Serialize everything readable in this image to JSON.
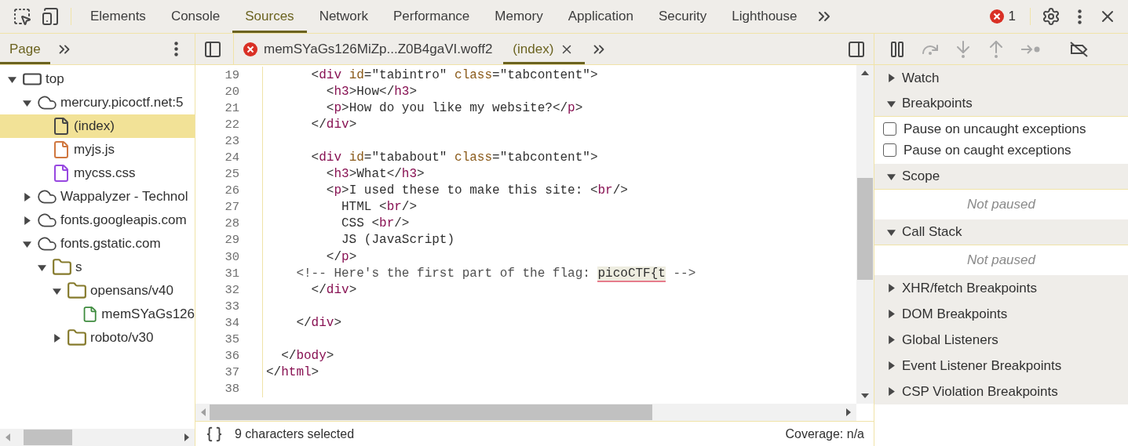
{
  "main_tabs": [
    {
      "label": "Elements",
      "selected": false
    },
    {
      "label": "Console",
      "selected": false
    },
    {
      "label": "Sources",
      "selected": true
    },
    {
      "label": "Network",
      "selected": false
    },
    {
      "label": "Performance",
      "selected": false
    },
    {
      "label": "Memory",
      "selected": false
    },
    {
      "label": "Application",
      "selected": false
    },
    {
      "label": "Security",
      "selected": false
    },
    {
      "label": "Lighthouse",
      "selected": false
    }
  ],
  "error_count": "1",
  "navigator_tabs": [
    {
      "label": "Page",
      "selected": true
    }
  ],
  "editor_tabs": [
    {
      "label": "memSYaGs126MiZp...Z0B4gaVI.woff2",
      "selected": false,
      "error": true
    },
    {
      "label": "(index)",
      "selected": true,
      "error": false
    }
  ],
  "debugger_controls": [
    {
      "kind": "pause",
      "disabled": false
    },
    {
      "kind": "step_over",
      "disabled": true
    },
    {
      "kind": "step_into",
      "disabled": true
    },
    {
      "kind": "step_out",
      "disabled": true
    },
    {
      "kind": "step",
      "disabled": true
    },
    {
      "kind": "deactivate",
      "disabled": false
    }
  ],
  "tree": [
    {
      "label": "top",
      "kind": "frame",
      "expanded": true,
      "selected": false,
      "children": [
        {
          "label": "mercury.picoctf.net:5",
          "kind": "domain",
          "expanded": true,
          "selected": false,
          "children": [
            {
              "label": "(index)",
              "kind": "file",
              "color": "#474747",
              "selected": true
            },
            {
              "label": "myjs.js",
              "kind": "file",
              "color": "#d0773f",
              "selected": false
            },
            {
              "label": "mycss.css",
              "kind": "file",
              "color": "#9747e0",
              "selected": false
            }
          ]
        },
        {
          "label": "Wappalyzer - Technol",
          "kind": "domain",
          "expanded": false,
          "selected": false
        },
        {
          "label": "fonts.googleapis.com",
          "kind": "domain",
          "expanded": false,
          "selected": false
        },
        {
          "label": "fonts.gstatic.com",
          "kind": "domain",
          "expanded": true,
          "selected": false,
          "children": [
            {
              "label": "s",
              "kind": "folder",
              "expanded": true,
              "selected": false,
              "children": [
                {
                  "label": "opensans/v40",
                  "kind": "folder",
                  "expanded": true,
                  "selected": false,
                  "children": [
                    {
                      "label": "memSYaGs126",
                      "kind": "file",
                      "color": "#3d8b3d",
                      "selected": false
                    }
                  ]
                },
                {
                  "label": "roboto/v30",
                  "kind": "folder",
                  "expanded": false,
                  "selected": false
                }
              ]
            }
          ]
        }
      ]
    }
  ],
  "code_lines": [
    {
      "number": "19",
      "tokens": [
        {
          "kind": "punct",
          "text": "      <"
        },
        {
          "kind": "tag",
          "text": "div "
        },
        {
          "kind": "attr",
          "text": "id"
        },
        {
          "kind": "punct",
          "text": "=\"tabintro\" "
        },
        {
          "kind": "attr",
          "text": "class"
        },
        {
          "kind": "punct",
          "text": "=\"tabcontent\">"
        }
      ]
    },
    {
      "number": "20",
      "tokens": [
        {
          "kind": "punct",
          "text": "        <"
        },
        {
          "kind": "tag",
          "text": "h3"
        },
        {
          "kind": "punct",
          "text": ">How</"
        },
        {
          "kind": "tag",
          "text": "h3"
        },
        {
          "kind": "punct",
          "text": ">"
        }
      ]
    },
    {
      "number": "21",
      "tokens": [
        {
          "kind": "punct",
          "text": "        <"
        },
        {
          "kind": "tag",
          "text": "p"
        },
        {
          "kind": "punct",
          "text": ">How do you like my website?</"
        },
        {
          "kind": "tag",
          "text": "p"
        },
        {
          "kind": "punct",
          "text": ">"
        }
      ]
    },
    {
      "number": "22",
      "tokens": [
        {
          "kind": "punct",
          "text": "      </"
        },
        {
          "kind": "tag",
          "text": "div"
        },
        {
          "kind": "punct",
          "text": ">"
        }
      ]
    },
    {
      "number": "23"
    },
    {
      "number": "24",
      "tokens": [
        {
          "kind": "punct",
          "text": "      <"
        },
        {
          "kind": "tag",
          "text": "div "
        },
        {
          "kind": "attr",
          "text": "id"
        },
        {
          "kind": "punct",
          "text": "=\"tababout\" "
        },
        {
          "kind": "attr",
          "text": "class"
        },
        {
          "kind": "punct",
          "text": "=\"tabcontent\">"
        }
      ]
    },
    {
      "number": "25",
      "tokens": [
        {
          "kind": "punct",
          "text": "        <"
        },
        {
          "kind": "tag",
          "text": "h3"
        },
        {
          "kind": "punct",
          "text": ">What</"
        },
        {
          "kind": "tag",
          "text": "h3"
        },
        {
          "kind": "punct",
          "text": ">"
        }
      ]
    },
    {
      "number": "26",
      "tokens": [
        {
          "kind": "punct",
          "text": "        <"
        },
        {
          "kind": "tag",
          "text": "p"
        },
        {
          "kind": "punct",
          "text": ">I used these to make this site: <"
        },
        {
          "kind": "tag",
          "text": "br"
        },
        {
          "kind": "punct",
          "text": "/>"
        }
      ]
    },
    {
      "number": "27",
      "tokens": [
        {
          "kind": "punct",
          "text": "          HTML <"
        },
        {
          "kind": "tag",
          "text": "br"
        },
        {
          "kind": "punct",
          "text": "/>"
        }
      ]
    },
    {
      "number": "28",
      "tokens": [
        {
          "kind": "punct",
          "text": "          CSS <"
        },
        {
          "kind": "tag",
          "text": "br"
        },
        {
          "kind": "punct",
          "text": "/>"
        }
      ]
    },
    {
      "number": "29",
      "tokens": [
        {
          "kind": "punct",
          "text": "          JS (JavaScript)"
        }
      ]
    },
    {
      "number": "30",
      "tokens": [
        {
          "kind": "punct",
          "text": "        </"
        },
        {
          "kind": "tag",
          "text": "p"
        },
        {
          "kind": "punct",
          "text": ">"
        }
      ]
    },
    {
      "number": "31",
      "tokens": [
        {
          "kind": "comment",
          "text": "    <!-- Here's the first part of the flag: "
        },
        {
          "kind": "selection",
          "text": "picoCTF{t"
        },
        {
          "kind": "comment",
          "text": " -->"
        }
      ]
    },
    {
      "number": "32",
      "tokens": [
        {
          "kind": "punct",
          "text": "      </"
        },
        {
          "kind": "tag",
          "text": "div"
        },
        {
          "kind": "punct",
          "text": ">"
        }
      ]
    },
    {
      "number": "33"
    },
    {
      "number": "34",
      "tokens": [
        {
          "kind": "punct",
          "text": "    </"
        },
        {
          "kind": "tag",
          "text": "div"
        },
        {
          "kind": "punct",
          "text": ">"
        }
      ]
    },
    {
      "number": "35"
    },
    {
      "number": "36",
      "tokens": [
        {
          "kind": "punct",
          "text": "  </"
        },
        {
          "kind": "tag",
          "text": "body"
        },
        {
          "kind": "punct",
          "text": ">"
        }
      ]
    },
    {
      "number": "37",
      "tokens": [
        {
          "kind": "punct",
          "text": "</"
        },
        {
          "kind": "tag",
          "text": "html"
        },
        {
          "kind": "punct",
          "text": ">"
        }
      ]
    },
    {
      "number": "38"
    }
  ],
  "status": {
    "selection": "9 characters selected",
    "coverage": "Coverage: n/a"
  },
  "sections": [
    {
      "title": "Watch",
      "expanded": false
    },
    {
      "title": "Breakpoints",
      "expanded": true,
      "checkboxes": [
        {
          "label": "Pause on uncaught exceptions",
          "checked": false
        },
        {
          "label": "Pause on caught exceptions",
          "checked": false
        }
      ]
    },
    {
      "title": "Scope",
      "expanded": true,
      "message": "Not paused"
    },
    {
      "title": "Call Stack",
      "expanded": true,
      "message": "Not paused"
    },
    {
      "title": "XHR/fetch Breakpoints",
      "expanded": false
    },
    {
      "title": "DOM Breakpoints",
      "expanded": false
    },
    {
      "title": "Global Listeners",
      "expanded": false
    },
    {
      "title": "Event Listener Breakpoints",
      "expanded": false
    },
    {
      "title": "CSP Violation Breakpoints",
      "expanded": false
    }
  ]
}
